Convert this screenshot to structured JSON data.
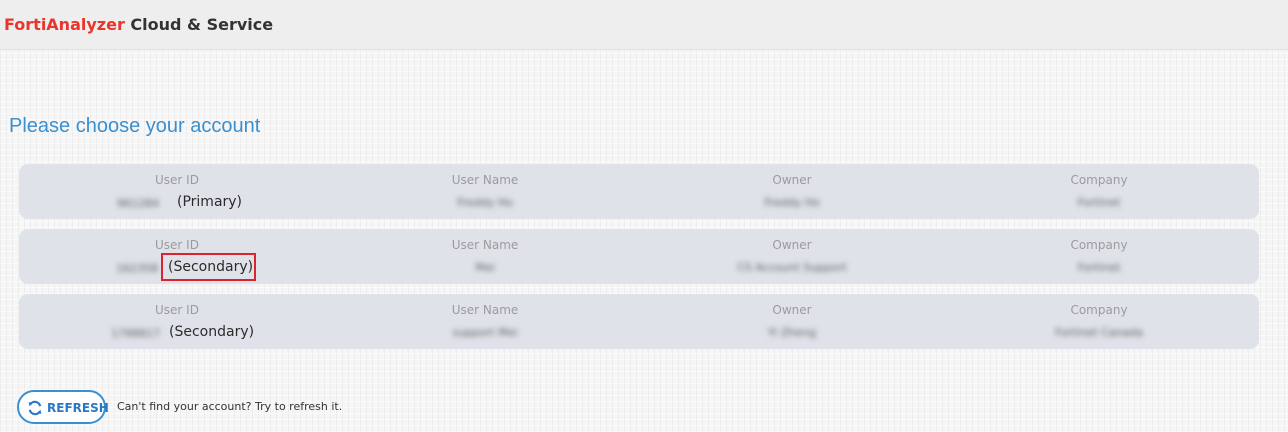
{
  "header": {
    "product": "FortiAnalyzer",
    "suffix": "Cloud & Service"
  },
  "page": {
    "title": "Please choose your account"
  },
  "columns": {
    "user_id": "User ID",
    "user_name": "User Name",
    "owner": "Owner",
    "company": "Company"
  },
  "accounts": [
    {
      "user_id": "961284",
      "role": "(Primary)",
      "user_name": "Freddy Ho",
      "owner": "Freddy Ho",
      "company": "Fortinet"
    },
    {
      "user_id": "162358",
      "role": "(Secondary)",
      "user_name": "Mei",
      "owner": "CS Account Support",
      "company": "Fortinet"
    },
    {
      "user_id": "1798817",
      "role": "(Secondary)",
      "user_name": "support Mei",
      "owner": "Yi Zheng",
      "company": "Fortinet Canada"
    }
  ],
  "refresh": {
    "label": "REFRESH",
    "icon": "refresh-icon",
    "help": "Can't find your account? Try to refresh it."
  },
  "colors": {
    "brand_red": "#e8362c",
    "accent_blue": "#3a8fd0",
    "row_bg": "#dfe3e9",
    "highlight": "#d9262e"
  }
}
